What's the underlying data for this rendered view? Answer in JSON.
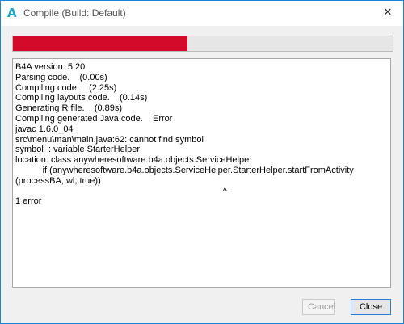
{
  "window": {
    "app_icon_glyph": "A",
    "title": "Compile (Build: Default)",
    "close_glyph": "✕"
  },
  "progress": {
    "fraction": 0.46,
    "color": "#d40a2a"
  },
  "log": {
    "lines": [
      "B4A version: 5.20",
      "Parsing code.    (0.00s)",
      "Compiling code.    (2.25s)",
      "Compiling layouts code.    (0.14s)",
      "Generating R file.    (0.89s)",
      "Compiling generated Java code.    Error",
      "javac 1.6.0_04",
      "src\\menu\\man\\main.java:62: cannot find symbol",
      "symbol  : variable StarterHelper",
      "location: class anywheresoftware.b4a.objects.ServiceHelper",
      "           if (anywheresoftware.b4a.objects.ServiceHelper.StarterHelper.startFromActivity",
      "(processBA, wl, true))",
      "                                                                                    ^",
      "1 error"
    ]
  },
  "buttons": {
    "cancel_label": "Cancel",
    "close_label": "Close"
  }
}
